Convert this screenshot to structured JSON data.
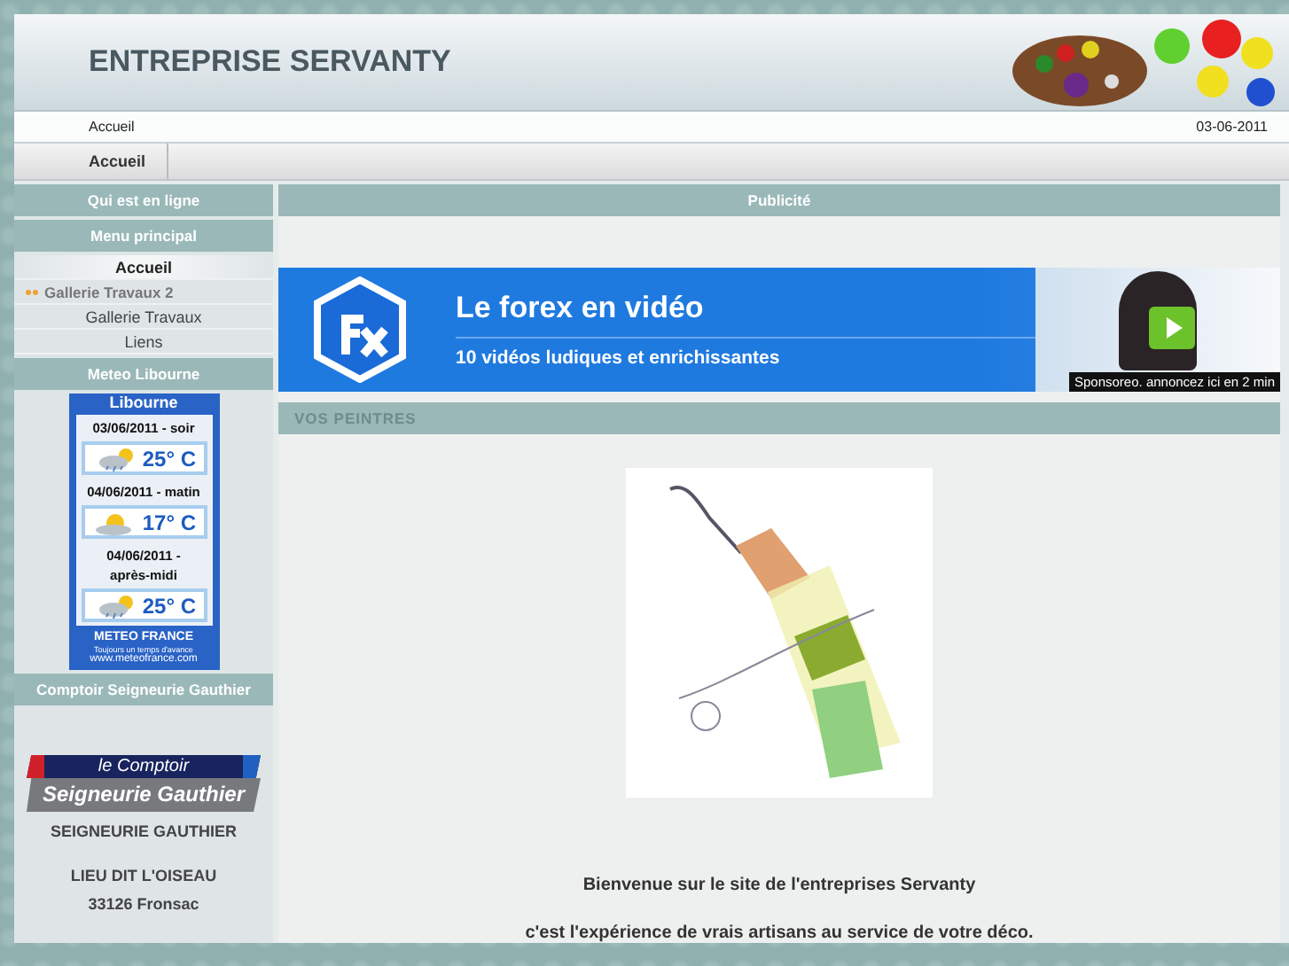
{
  "header": {
    "title": "ENTREPRISE SERVANTY"
  },
  "breadcrumb": {
    "path": "Accueil",
    "date": "03-06-2011"
  },
  "nav": [
    {
      "label": "Accueil",
      "selected": true
    }
  ],
  "sidebar": {
    "online": {
      "title": "Qui est en ligne"
    },
    "menu": {
      "title": "Menu principal",
      "items": [
        {
          "label": "Accueil",
          "kind": "item",
          "selected": true
        },
        {
          "label": "Gallerie Travaux 2",
          "kind": "sub",
          "selected": false
        },
        {
          "label": "Gallerie Travaux",
          "kind": "item",
          "selected": false
        },
        {
          "label": "Liens",
          "kind": "item",
          "selected": false
        }
      ]
    },
    "weather": {
      "title": "Meteo Libourne",
      "city": "Libourne",
      "forecasts": [
        {
          "date": "03/06/2011 - soir",
          "temp": "25° C",
          "kind": "showers"
        },
        {
          "date": "04/06/2011 - matin",
          "temp": "17° C",
          "kind": "sunny-intervals"
        },
        {
          "date": "04/06/2011 - après-midi",
          "temp": "25° C",
          "kind": "showers"
        }
      ],
      "brand": "METEO FRANCE",
      "tagline": "Toujours un temps d'avance",
      "url": "www.meteofrance.com"
    },
    "shop": {
      "title": "Comptoir Seigneurie Gauthier",
      "logo_top": "le Comptoir",
      "logo_bottom": "Seigneurie Gauthier",
      "name": "SEIGNEURIE GAUTHIER",
      "address": [
        "LIEU DIT L'OISEAU",
        "33126 Fronsac"
      ]
    }
  },
  "main": {
    "ad_title": "Publicité",
    "ad": {
      "headline": "Le forex en vidéo",
      "subline": "10 vidéos ludiques et enrichissantes",
      "sponsor": "Sponsoreo. annoncez ici en 2 min"
    },
    "section_title": "VOS PEINTRES",
    "paragraphs": [
      "Bienvenue sur le site de l'entreprises Servanty",
      "c'est l'expérience de vrais artisans au service de votre déco."
    ]
  }
}
